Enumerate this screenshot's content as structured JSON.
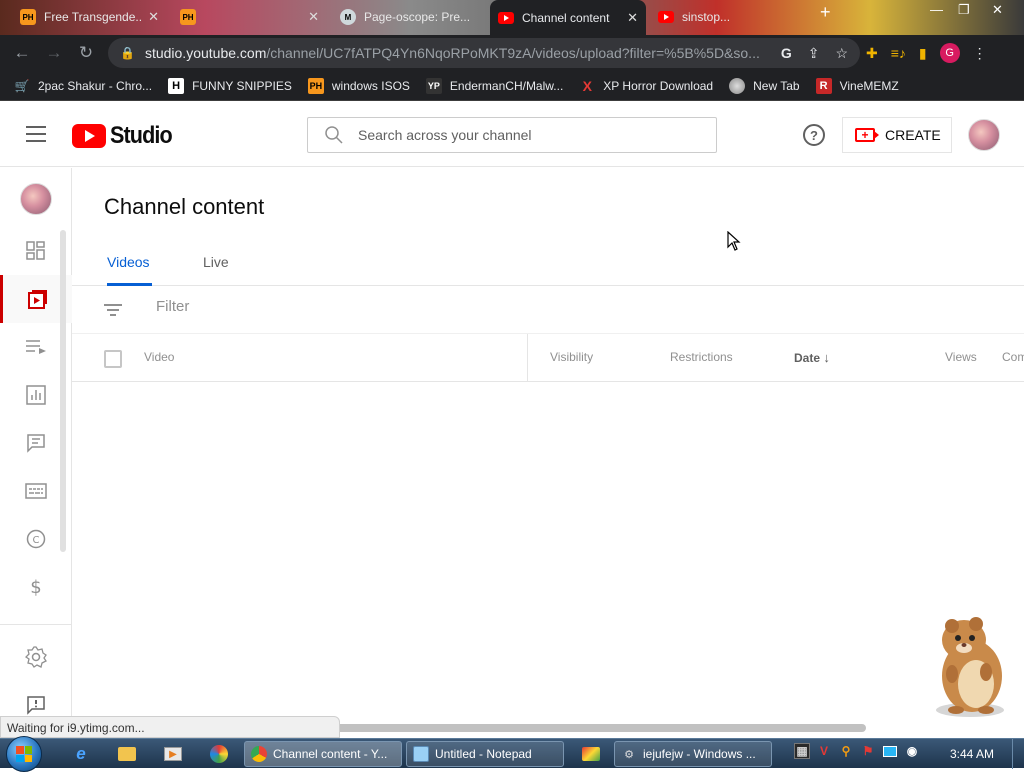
{
  "browser": {
    "tabs": [
      {
        "label": "Free Transgende...",
        "favicon": "PH",
        "fav_bg": "#f7971d"
      },
      {
        "label": "",
        "favicon": "PH",
        "fav_bg": "#f7971d"
      },
      {
        "label": "Page-oscope: Pre...",
        "favicon": "M",
        "fav_bg": "#cfd8dc"
      },
      {
        "label": "Channel content",
        "favicon": "yt",
        "fav_bg": "#ff0000"
      },
      {
        "label": "sinstop...",
        "favicon": "yt",
        "fav_bg": "#ff0000"
      }
    ],
    "url_host": "studio.youtube.com",
    "url_path": "/channel/UC7fATPQ4Yn6NqoRPoMKT9zA/videos/upload?filter=%5B%5D&so...",
    "profile_initial": "G",
    "bookmarks": [
      {
        "label": "2pac Shakur - Chro...",
        "icon": "cart-icon"
      },
      {
        "label": "FUNNY SNIPPIES",
        "icon": "H"
      },
      {
        "label": "windows ISOS",
        "icon": "PH"
      },
      {
        "label": "EndermanCH/Malw...",
        "icon": "YP"
      },
      {
        "label": "XP Horror Download",
        "icon": "X"
      },
      {
        "label": "New Tab",
        "icon": "globe-icon"
      },
      {
        "label": "VineMEMZ",
        "icon": "R"
      }
    ]
  },
  "studio": {
    "logo_text": "Studio",
    "search_placeholder": "Search across your channel",
    "create_label": "CREATE",
    "page_title": "Channel content",
    "tabs": [
      "Videos",
      "Live"
    ],
    "filter_placeholder": "Filter",
    "columns": [
      "Video",
      "Visibility",
      "Restrictions",
      "Date",
      "Views",
      "Com"
    ],
    "date_sort_arrow": "↓",
    "status_text": "Waiting for i9.ytimg.com..."
  },
  "taskbar": {
    "tasks": [
      {
        "label": "Channel content - Y..."
      },
      {
        "label": "Untitled - Notepad"
      },
      {
        "label": "iejufejw - Windows ..."
      }
    ],
    "clock": "3:44 AM"
  },
  "colors": {
    "accent_blue": "#065fd4",
    "youtube_red": "#ff0000",
    "active_nav_red": "#cc0000"
  }
}
